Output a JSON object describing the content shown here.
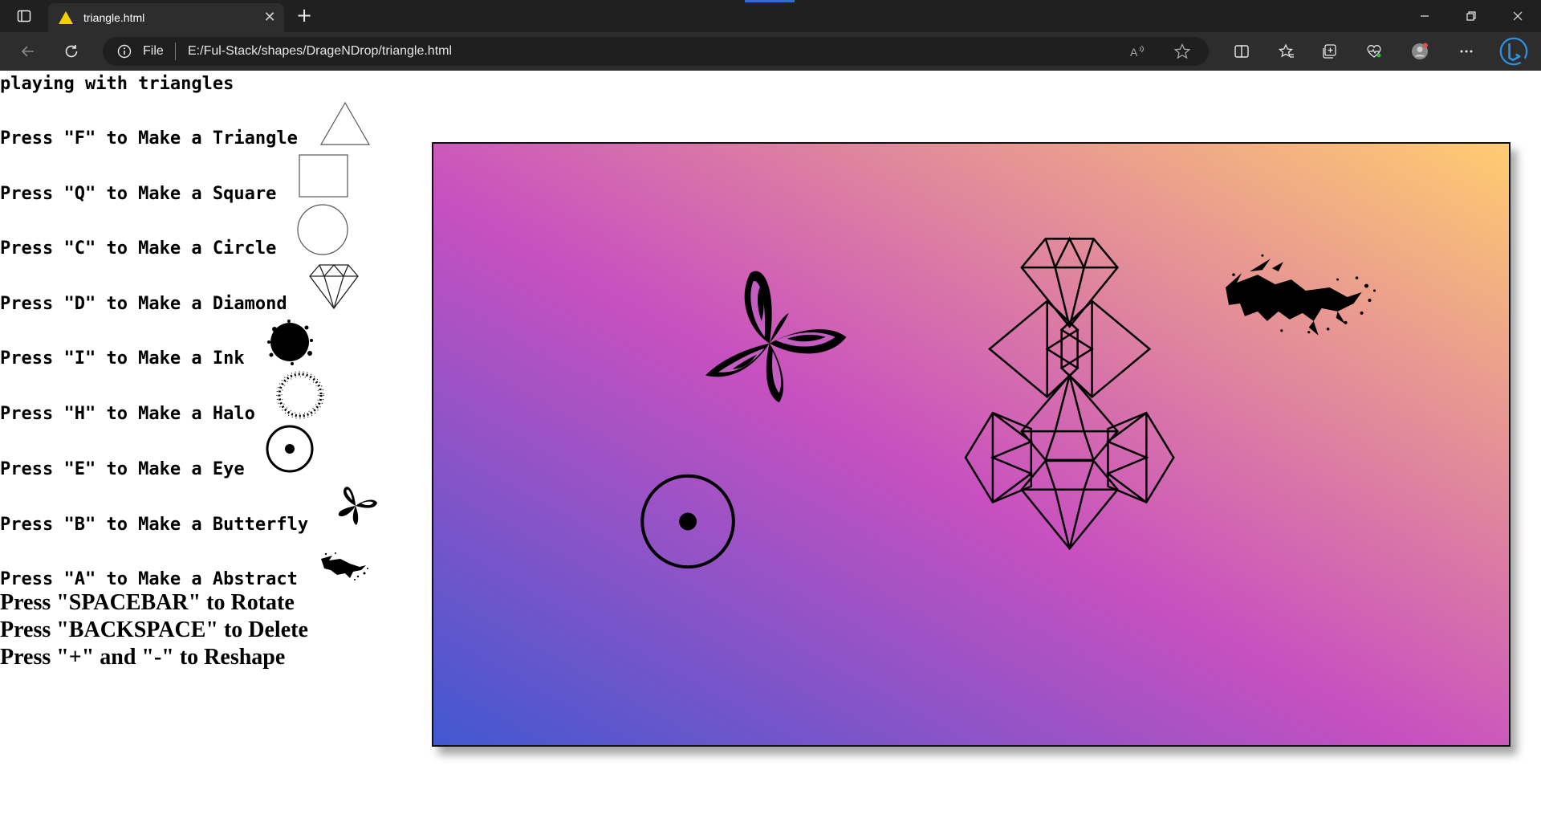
{
  "tab": {
    "title": "triangle.html"
  },
  "address": {
    "scheme": "File",
    "url": "E:/Ful-Stack/shapes/DrageNDrop/triangle.html"
  },
  "page": {
    "heading": "playing with triangles",
    "instructions": [
      {
        "text": "Press \"F\" to Make a Triangle",
        "icon": "triangle-icon"
      },
      {
        "text": "Press \"Q\" to Make a Square",
        "icon": "square-icon"
      },
      {
        "text": "Press \"C\" to Make a Circle",
        "icon": "circle-icon"
      },
      {
        "text": "Press \"D\" to Make a Diamond",
        "icon": "diamond-icon"
      },
      {
        "text": "Press \"I\" to Make a Ink",
        "icon": "ink-icon"
      },
      {
        "text": "Press \"H\" to Make a Halo",
        "icon": "halo-icon"
      },
      {
        "text": "Press \"E\" to Make a Eye",
        "icon": "eye-icon"
      },
      {
        "text": "Press \"B\" to Make a Butterfly",
        "icon": "butterfly-icon"
      },
      {
        "text": "Press \"A\" to Make a Abstract",
        "icon": "abstract-icon"
      }
    ],
    "controls": [
      "Press \"SPACEBAR\" to Rotate",
      "Press \"BACKSPACE\" to Delete",
      "Press \"+\" and \"-\" to Reshape"
    ]
  },
  "canvas": {
    "gradient": [
      "#4158d0",
      "#c850c0",
      "#ffcc70"
    ],
    "shapes": [
      "butterfly",
      "eye",
      "diamond-cluster",
      "abstract-splash"
    ]
  },
  "colors": {
    "tabbar": "#202020",
    "toolbar": "#2d2d2d",
    "addressbar": "#1f1f1f",
    "favicon": "#f5d000",
    "accent": "#2f6dd2"
  }
}
